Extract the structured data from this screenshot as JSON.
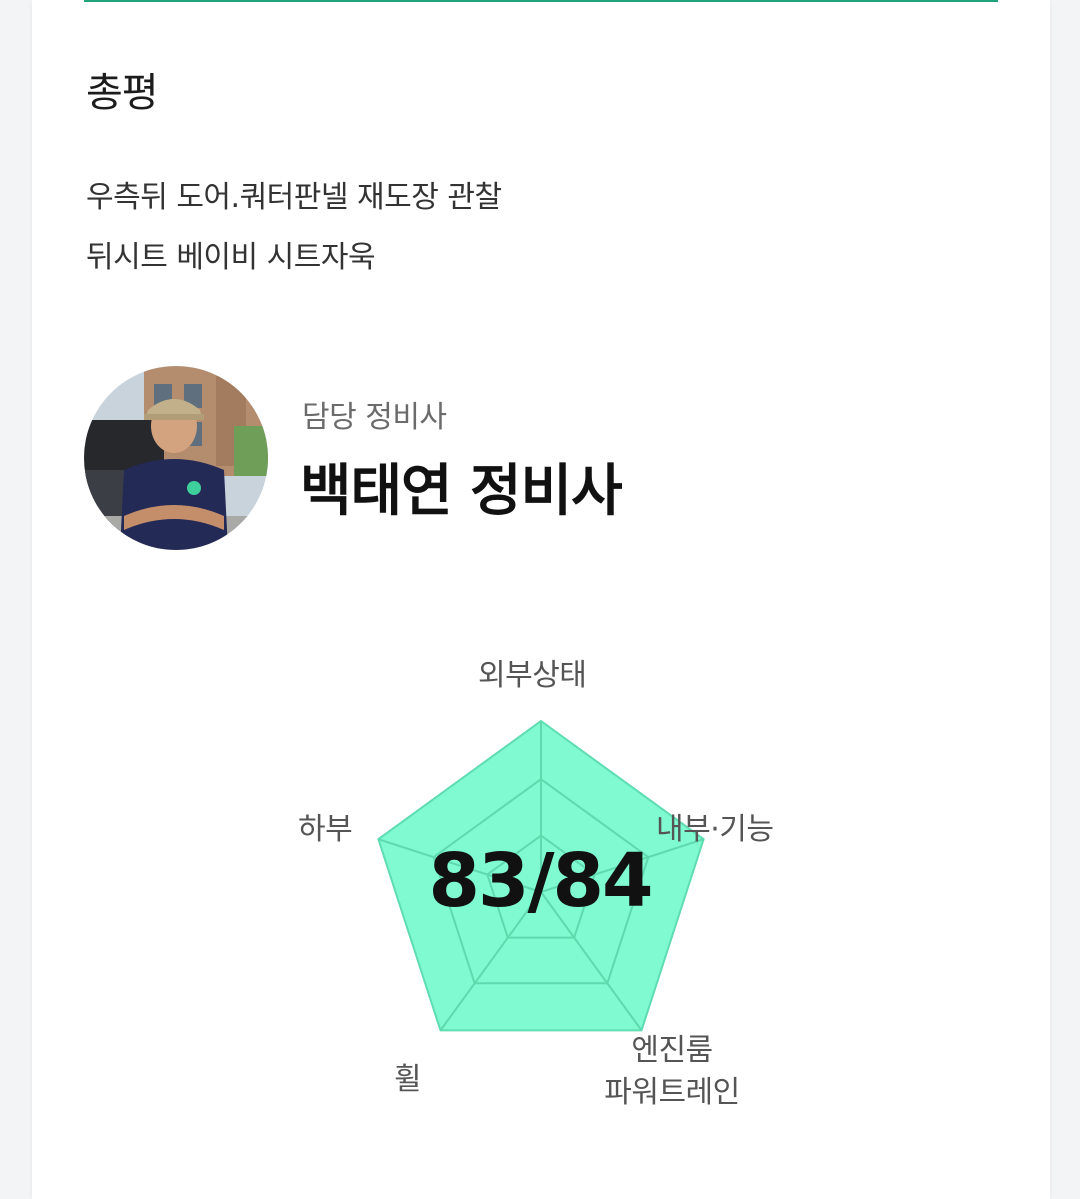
{
  "review": {
    "title": "총평",
    "lines": [
      "우측뒤 도어.쿼터판넬 재도장 관찰",
      "뒤시트 베이비 시트자욱"
    ]
  },
  "mechanic": {
    "role_label": "담당 정비사",
    "name": "백태연 정비사"
  },
  "radar": {
    "axes": [
      {
        "label": "외부상태"
      },
      {
        "label": "내부·기능"
      },
      {
        "label_lines": [
          "엔진룸",
          "파워트레인"
        ]
      },
      {
        "label": "휠"
      },
      {
        "label": "하부"
      }
    ],
    "values": [
      1.0,
      1.0,
      1.0,
      1.0,
      1.0
    ],
    "score_text": "83/84",
    "fill_color": "#7ffad1",
    "stroke_color": "#5fdcb0",
    "grid_color": "#5fd9ad"
  },
  "colors": {
    "accent": "#1fa37a"
  }
}
